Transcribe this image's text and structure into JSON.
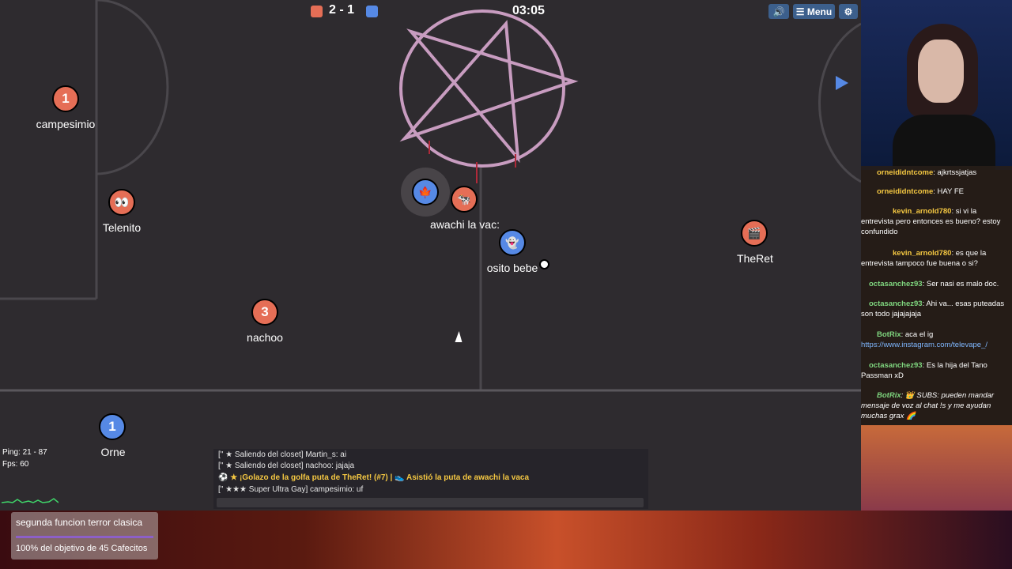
{
  "scoreboard": {
    "red_score": "2",
    "separator": "-",
    "blue_score": "1",
    "timer": "03:05",
    "red_color": "#e56e56",
    "blue_color": "#5689e5"
  },
  "toolbar": {
    "sound_label": "🔊",
    "menu_label": "☰ Menu",
    "settings_label": "⚙"
  },
  "players": [
    {
      "name": "campesimio",
      "team": "red",
      "avatar": "1"
    },
    {
      "name": "Telenito",
      "team": "red",
      "avatar": "👀"
    },
    {
      "name": "nachoo",
      "team": "red",
      "avatar": "3"
    },
    {
      "name": "awachi la vac:",
      "team": "red",
      "avatar": "🐄"
    },
    {
      "name": "TheRet",
      "team": "red",
      "avatar": "🎬"
    },
    {
      "name": "",
      "team": "blue",
      "avatar": "🍁"
    },
    {
      "name": "osito bebe",
      "team": "blue",
      "avatar": "👻"
    },
    {
      "name": "Orne",
      "team": "blue",
      "avatar": "1"
    }
  ],
  "stats": {
    "ping": "Ping: 21 - 87",
    "fps": "Fps: 60"
  },
  "game_log": [
    {
      "text": "[\" ★ Saliendo del closet] Martin_s: ai",
      "style": "normal"
    },
    {
      "text": "[\" ★ Saliendo del closet] nachoo: jajaja",
      "style": "normal"
    },
    {
      "text": "⚽ ★ ¡Golazo de la golfa puta de TheRet! (#7) | 👟 Asistió la puta de awachi la vaca",
      "style": "gold"
    },
    {
      "text": "[\" ★★★ Super Ultra Gay] campesimio: uf",
      "style": "normal"
    }
  ],
  "goal_widget": {
    "title": "segunda funcion terror clasica",
    "progress_percent": 100,
    "caption": "100% del objetivo de 45 Cafecitos"
  },
  "stream_chat": [
    {
      "user": "orneididntcome",
      "msg": ": ajkrtssjatjas"
    },
    {
      "user": "orneididntcome",
      "msg": ": HAY FE"
    },
    {
      "user": "kevin_arnold780",
      "msg": ": si vi la entrevista pero entonces es bueno? estoy confundido"
    },
    {
      "user": "kevin_arnold780",
      "msg": ": es que la entrevista tampoco fue buena o si?"
    },
    {
      "user": "octasanchez93",
      "msg": ": Ser nasi es malo doc."
    },
    {
      "user": "octasanchez93",
      "msg": ": Ahi va... esas puteadas son todo jajajajaja"
    },
    {
      "user": "BotRix",
      "msg": ": aca el ig",
      "link": "https://www.instagram.com/televape_/"
    },
    {
      "user": "octasanchez93",
      "msg": ": Es la hija del Tano Passman xD"
    },
    {
      "user": "BotRix",
      "msg": ": 👑 SUBS: pueden mandar mensaje de voz al chat !s y me ayudan muchas grax 🌈"
    }
  ]
}
